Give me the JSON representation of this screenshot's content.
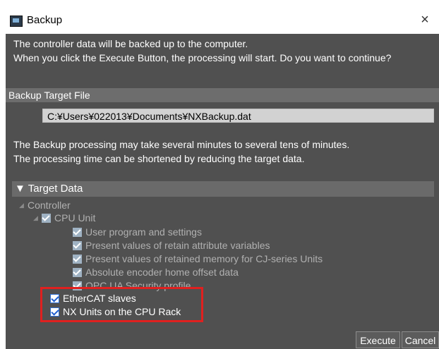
{
  "window": {
    "title": "Backup",
    "close_glyph": "×"
  },
  "message": {
    "line1": "The controller data will be backed up to the computer.",
    "line2": "When you click the Execute Button, the processing will start. Do you want to continue?"
  },
  "backup_target": {
    "label": "Backup Target File",
    "path": "C:¥Users¥022013¥Documents¥NXBackup.dat"
  },
  "note": {
    "line1": "The Backup processing may take several minutes to several tens of minutes.",
    "line2": "The processing time can be shortened by reducing the target data."
  },
  "target_data": {
    "header": "▼ Target Data",
    "controller": "Controller",
    "cpu_unit": "CPU Unit",
    "items": [
      "User program and settings",
      "Present values of retain attribute variables",
      "Present values of retained memory for CJ-series Units",
      "Absolute encoder home offset data",
      "OPC UA Security profile"
    ],
    "ethercat": "EtherCAT slaves",
    "nx_units": "NX Units on the CPU Rack"
  },
  "buttons": {
    "execute": "Execute",
    "cancel": "Cancel"
  },
  "colors": {
    "panel_bg": "#505050",
    "highlight": "#e0201f",
    "check_blue": "#1f5fd0"
  }
}
